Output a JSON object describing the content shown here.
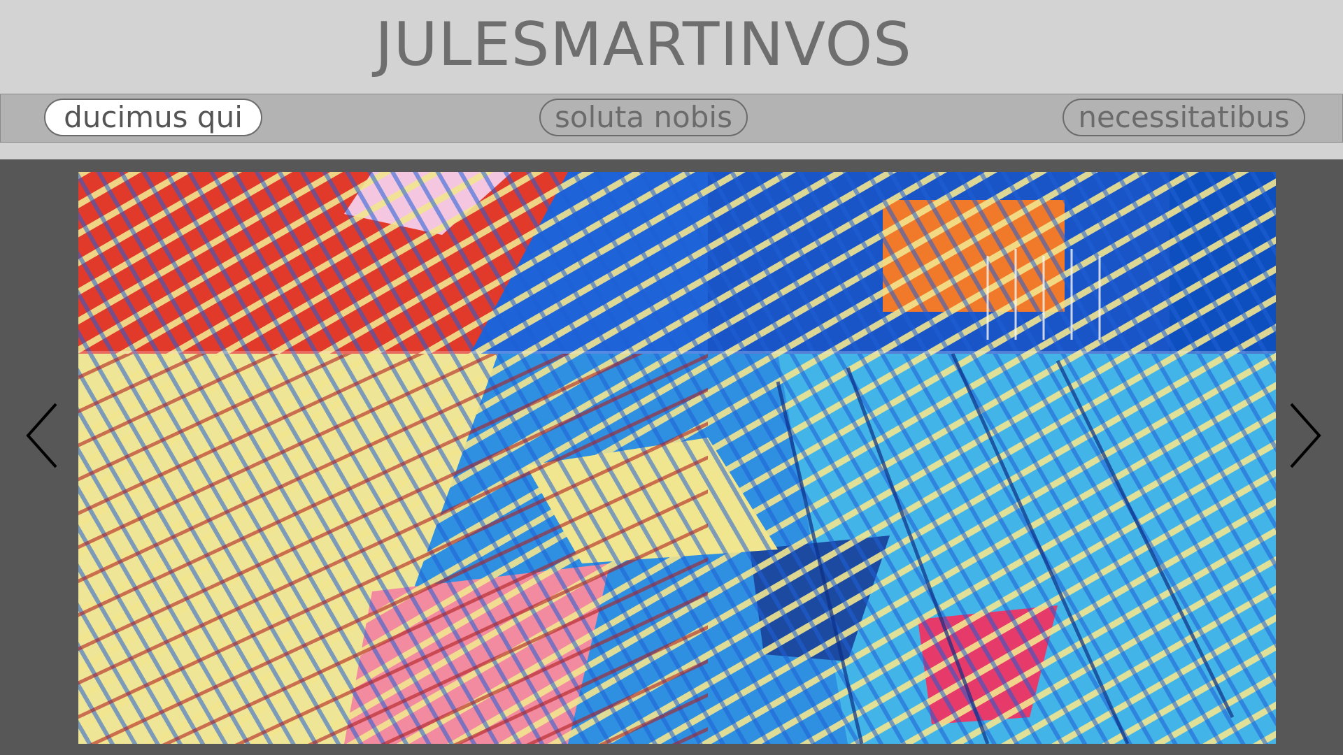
{
  "header": {
    "title": "JULESMARTINVOS"
  },
  "nav": {
    "items": [
      {
        "label": "ducimus qui",
        "active": true
      },
      {
        "label": "soluta nobis",
        "active": false
      },
      {
        "label": "necessitatibus",
        "active": false
      }
    ]
  },
  "slideshow": {
    "prev_icon": "chevron-left-icon",
    "next_icon": "chevron-right-icon",
    "image_description": "abstract colorful artwork"
  },
  "colors": {
    "page_background": "#d3d3d3",
    "nav_background": "#b3b3b3",
    "stage_background": "#575757",
    "title_color": "#6e6e6e"
  }
}
